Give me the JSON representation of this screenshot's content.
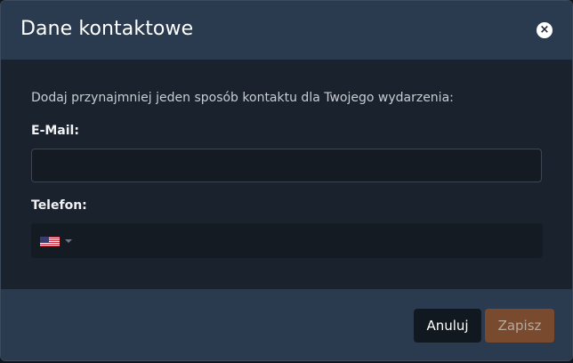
{
  "modal": {
    "title": "Dane kontaktowe",
    "close_icon": "×"
  },
  "body": {
    "intro": "Dodaj przynajmniej jeden sposób kontaktu dla Twojego wydarzenia:",
    "email": {
      "label": "E-Mail:",
      "value": "",
      "placeholder": ""
    },
    "phone": {
      "label": "Telefon:",
      "country_flag": "us-flag-icon",
      "value": "",
      "placeholder": ""
    }
  },
  "footer": {
    "cancel_label": "Anuluj",
    "save_label": "Zapisz"
  },
  "colors": {
    "header_bg": "#2a3a4f",
    "body_bg": "#1a222d",
    "save_button": "#7a4a2e",
    "cancel_button": "#121820"
  }
}
